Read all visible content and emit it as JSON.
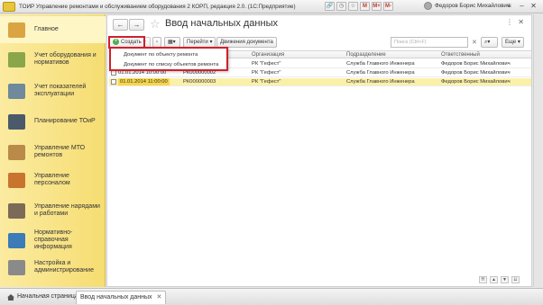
{
  "window": {
    "title": "ТОИР Управление ремонтами и обслуживанием оборудования 2 КОРП, редакция 2.0. (1С:Предприятие)",
    "title_icons": [
      "M",
      "M+",
      "M-"
    ],
    "user": "Федоров Борис Михайлович"
  },
  "sidebar": {
    "items": [
      {
        "label": "Главное",
        "icon": "home-icon",
        "color": "#d9a441"
      },
      {
        "label": "Учет оборудования и нормативов",
        "icon": "equipment-icon",
        "color": "#8aa64a"
      },
      {
        "label": "Учет показателей эксплуатации",
        "icon": "indicators-icon",
        "color": "#6e8a9c"
      },
      {
        "label": "Планирование ТОиР",
        "icon": "planning-icon",
        "color": "#4a5a6a"
      },
      {
        "label": "Управление МТО ремонтов",
        "icon": "mto-icon",
        "color": "#b98a4a"
      },
      {
        "label": "Управление персоналом",
        "icon": "personnel-icon",
        "color": "#c9742e"
      },
      {
        "label": "Управление нарядами и работами",
        "icon": "orders-icon",
        "color": "#7c6a58"
      },
      {
        "label": "Нормативно-справочная информация",
        "icon": "reference-icon",
        "color": "#3b7bb8"
      },
      {
        "label": "Настройка и администрирование",
        "icon": "settings-icon",
        "color": "#8a8a8a"
      }
    ]
  },
  "main": {
    "title": "Ввод начальных данных",
    "toolbar": {
      "create_label": "Создать",
      "goto_label": "Перейти",
      "movements_label": "Движения документа",
      "search_placeholder": "Поиск (Ctrl+F)",
      "more_label": "Еще"
    },
    "dropdown": {
      "items": [
        "Документ по объекту ремонта",
        "Документ по списку объектов ремонта"
      ]
    },
    "table": {
      "columns": [
        "Организация",
        "Подразделение",
        "Ответственный"
      ],
      "rows": [
        {
          "date": "",
          "number": "",
          "org": "РК \"Гефест\"",
          "dept": "Служба Главного Инженера",
          "resp": "Федоров Борис Михайлович"
        },
        {
          "date": "01.01.2014 10:00:00",
          "number": "РК000000002",
          "org": "РК \"Гефест\"",
          "dept": "Служба Главного Инженера",
          "resp": "Федоров Борис Михайлович"
        },
        {
          "date": "01.01.2014 11:00:00",
          "number": "РК000000003",
          "org": "РК \"Гефест\"",
          "dept": "Служба Главного Инженера",
          "resp": "Федоров Борис Михайлович"
        }
      ]
    }
  },
  "tabs": {
    "home": "Начальная страница",
    "active": "Ввод начальных данных"
  }
}
